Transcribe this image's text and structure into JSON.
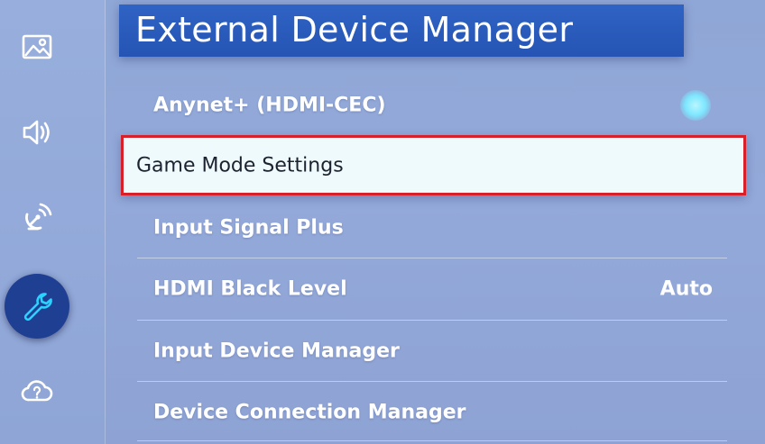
{
  "sidebar": {
    "items": [
      {
        "icon": "picture-icon",
        "active": false
      },
      {
        "icon": "sound-icon",
        "active": false
      },
      {
        "icon": "broadcasting-icon",
        "active": false
      },
      {
        "icon": "wrench-icon",
        "active": true
      },
      {
        "icon": "support-icon",
        "active": false
      }
    ]
  },
  "header": {
    "title": "External Device Manager"
  },
  "menu": {
    "items": [
      {
        "label": "Anynet+ (HDMI-CEC)",
        "value": "",
        "toggle": "on"
      },
      {
        "label": "Game Mode Settings",
        "value": "",
        "focused": true
      },
      {
        "label": "Input Signal Plus",
        "value": ""
      },
      {
        "label": "HDMI Black Level",
        "value": "Auto"
      },
      {
        "label": "Input Device Manager",
        "value": ""
      },
      {
        "label": "Device Connection Manager",
        "value": ""
      }
    ]
  },
  "colors": {
    "background": "#8fa7d6",
    "title_bg": "#2a5cbc",
    "focus_border": "#d8202a",
    "focus_bg": "#eefafb",
    "active_icon_bg": "#1f3f93",
    "toggle_on": "#7fe7ff"
  }
}
